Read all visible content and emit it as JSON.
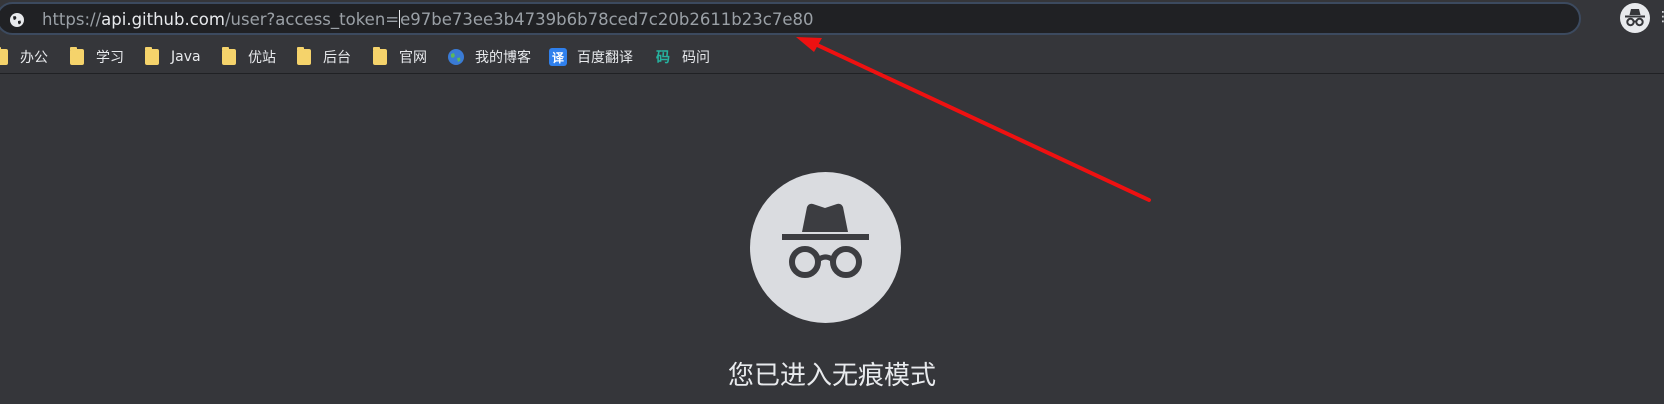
{
  "address_bar": {
    "scheme": "https://",
    "host": "api.github.com",
    "path_before_caret": "/user?access_token=",
    "path_after_caret": "e97be73ee3b4739b6b78ced7c20b2611b23c7e80"
  },
  "bookmarks": [
    {
      "label": "办公",
      "icon": "folder-icon"
    },
    {
      "label": "学习",
      "icon": "folder-icon"
    },
    {
      "label": "Java",
      "icon": "folder-icon"
    },
    {
      "label": "优站",
      "icon": "folder-icon"
    },
    {
      "label": "后台",
      "icon": "folder-icon"
    },
    {
      "label": "官网",
      "icon": "folder-icon"
    },
    {
      "label": "我的博客",
      "icon": "globe-icon"
    },
    {
      "label": "百度翻译",
      "icon": "translate-icon"
    },
    {
      "label": "码问",
      "icon": "mawen-icon"
    }
  ],
  "bookmark_icon_glyphs": {
    "translate": "译",
    "mawen": "码"
  },
  "incognito": {
    "heading": "您已进入无痕模式"
  },
  "colors": {
    "background": "#35363a",
    "omnibox": "#202124",
    "text": "#e8eaed",
    "folder": "#f5d36b",
    "arrow": "#ee1111",
    "icon_circle": "#dadce0"
  }
}
